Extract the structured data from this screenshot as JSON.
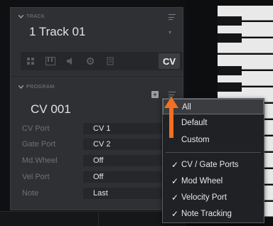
{
  "track": {
    "section_label": "TRACK",
    "name": "1 Track 01"
  },
  "icon_row": {
    "icons": [
      "grid-icon",
      "piano-icon",
      "speaker-icon",
      "gear-icon",
      "file-icon"
    ],
    "cv_label": "CV"
  },
  "program": {
    "section_label": "PROGRAM",
    "name": "CV 001"
  },
  "params": [
    {
      "label": "CV Port",
      "value": "CV 1"
    },
    {
      "label": "Gate Port",
      "value": "CV 2"
    },
    {
      "label": "Md.Wheel",
      "value": "Off"
    },
    {
      "label": "Vel Port",
      "value": "Off"
    },
    {
      "label": "Note",
      "value": "Last"
    }
  ],
  "dropdown": {
    "group1": [
      {
        "label": "All",
        "checked": false,
        "selected": true
      },
      {
        "label": "Default",
        "checked": false,
        "selected": false
      },
      {
        "label": "Custom",
        "checked": false,
        "selected": false
      }
    ],
    "group2": [
      {
        "label": "CV / Gate Ports",
        "checked": true
      },
      {
        "label": "Mod Wheel",
        "checked": true
      },
      {
        "label": "Velocity Port",
        "checked": true
      },
      {
        "label": "Note Tracking",
        "checked": true
      }
    ],
    "check_glyph": "✓"
  },
  "colors": {
    "panel": "#2e3033",
    "field": "#25272a",
    "arrow": "#f36f21",
    "selected_bg": "#3a3c40"
  }
}
